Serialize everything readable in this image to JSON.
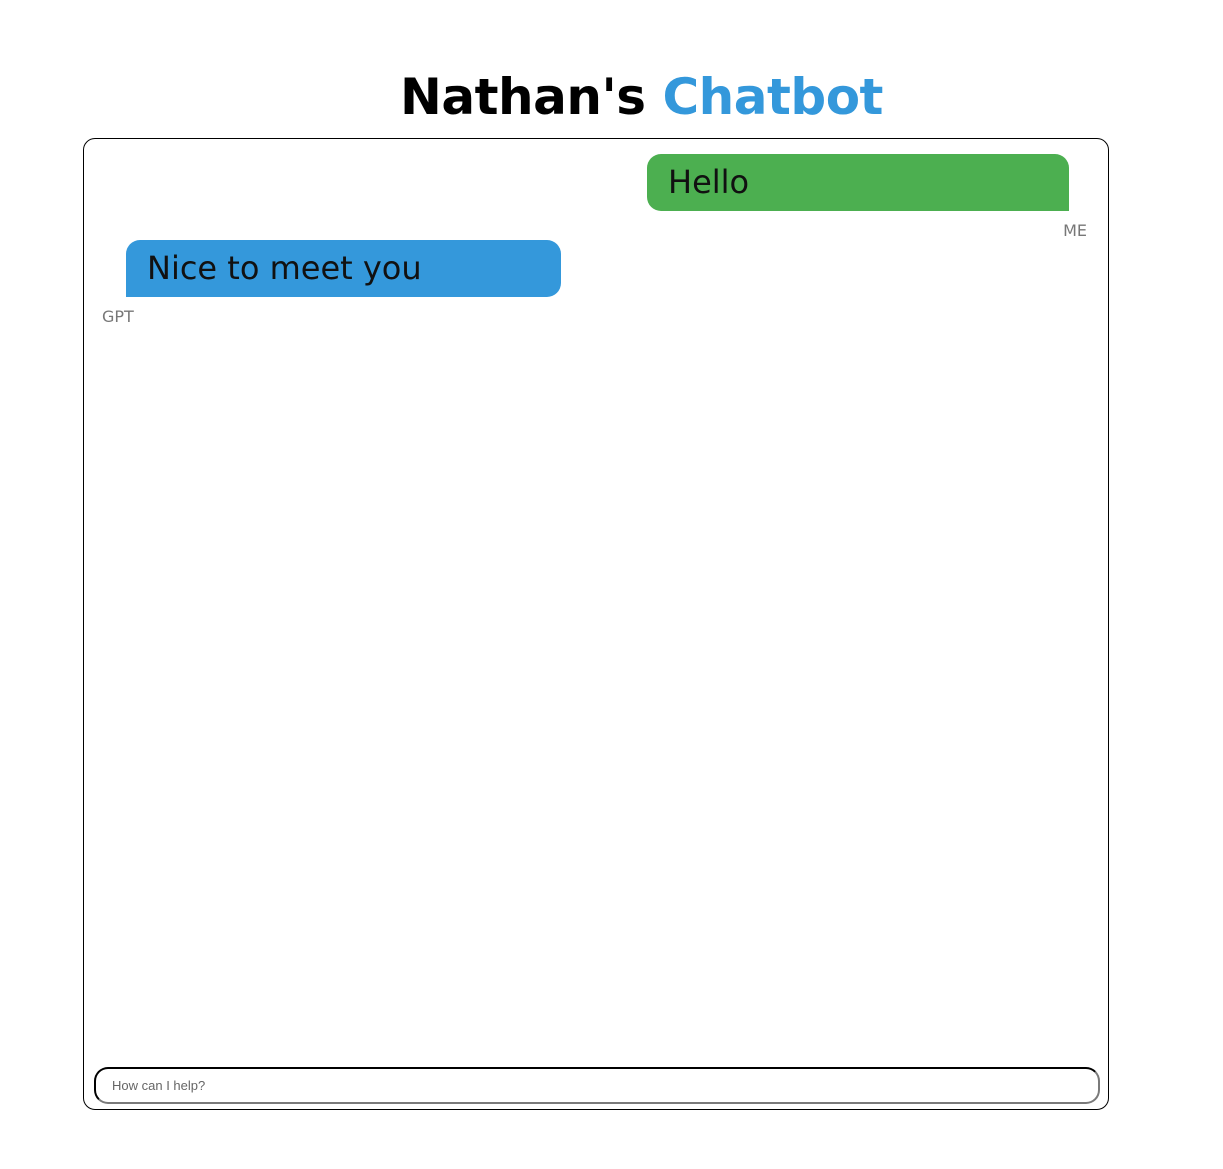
{
  "header": {
    "title_prefix": "Nathan's",
    "title_accent": "Chatbot"
  },
  "colors": {
    "accent": "#3498db",
    "user_bubble": "#4caf50",
    "bot_bubble": "#3498db"
  },
  "chat": {
    "messages": [
      {
        "sender": "ME",
        "text": "Hello"
      },
      {
        "sender": "GPT",
        "text": "Nice to meet you"
      }
    ]
  },
  "input": {
    "value": "",
    "placeholder": "How can I help?"
  }
}
